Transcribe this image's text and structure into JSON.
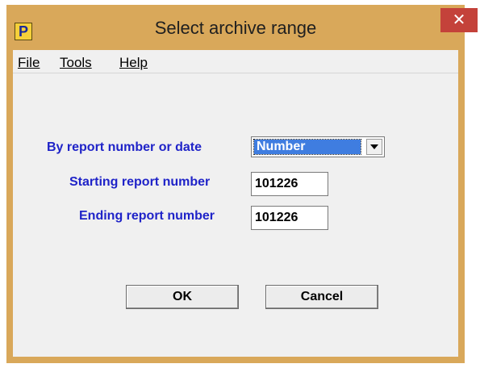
{
  "window": {
    "title": "Select archive range",
    "app_icon_letter": "P",
    "close_glyph": "✕"
  },
  "menu": {
    "file": "File",
    "tools": "Tools",
    "help": "Help"
  },
  "form": {
    "mode_label": "By report number or date",
    "mode_value": "Number",
    "start_label": "Starting report number",
    "start_value": "101226",
    "end_label": "Ending report number",
    "end_value": "101226"
  },
  "buttons": {
    "ok": "OK",
    "cancel": "Cancel"
  },
  "colors": {
    "title_bar": "#d9a85a",
    "close_button": "#c4423a",
    "label_text": "#1f23c8",
    "selection": "#3f7de0"
  }
}
